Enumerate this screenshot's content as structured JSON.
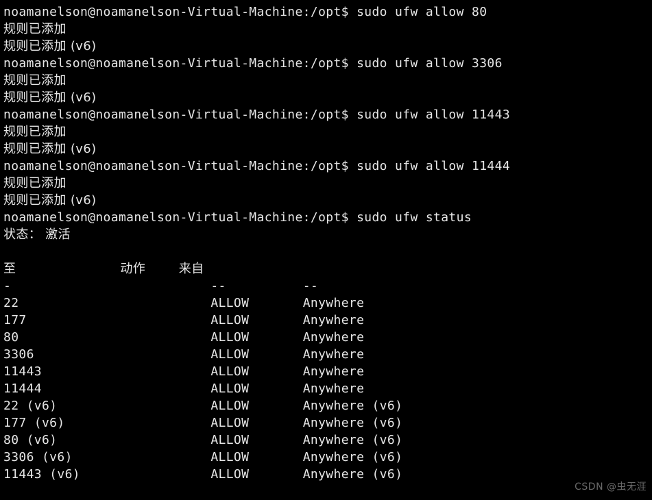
{
  "terminal": {
    "prompt": "noamanelson@noamanelson-Virtual-Machine:/opt$",
    "colors": {
      "background": "#000000",
      "foreground": "#e6e6e6",
      "watermark": "#6a6a6a"
    },
    "lines": [
      {
        "type": "command",
        "prompt": "noamanelson@noamanelson-Virtual-Machine:/opt$",
        "command": " sudo ufw allow 80"
      },
      {
        "type": "output",
        "text": "规则已添加"
      },
      {
        "type": "output",
        "text": "规则已添加 (v6)"
      },
      {
        "type": "command",
        "prompt": "noamanelson@noamanelson-Virtual-Machine:/opt$",
        "command": " sudo ufw allow 3306"
      },
      {
        "type": "output",
        "text": "规则已添加"
      },
      {
        "type": "output",
        "text": "规则已添加 (v6)"
      },
      {
        "type": "command",
        "prompt": "noamanelson@noamanelson-Virtual-Machine:/opt$",
        "command": " sudo ufw allow 11443"
      },
      {
        "type": "output",
        "text": "规则已添加"
      },
      {
        "type": "output",
        "text": "规则已添加 (v6)"
      },
      {
        "type": "command",
        "prompt": "noamanelson@noamanelson-Virtual-Machine:/opt$",
        "command": " sudo ufw allow 11444"
      },
      {
        "type": "output",
        "text": "规则已添加"
      },
      {
        "type": "output",
        "text": "规则已添加 (v6)"
      },
      {
        "type": "command",
        "prompt": "noamanelson@noamanelson-Virtual-Machine:/opt$",
        "command": " sudo ufw status"
      },
      {
        "type": "output",
        "text": "状态： 激活"
      },
      {
        "type": "blank",
        "text": ""
      },
      {
        "type": "table-header",
        "to": "至",
        "action": "动作",
        "from": "来自"
      },
      {
        "type": "table-separator",
        "to": "-",
        "action": "--",
        "from": "--"
      },
      {
        "type": "table-row",
        "to": "22",
        "action": "ALLOW",
        "from": "Anywhere"
      },
      {
        "type": "table-row",
        "to": "177",
        "action": "ALLOW",
        "from": "Anywhere"
      },
      {
        "type": "table-row",
        "to": "80",
        "action": "ALLOW",
        "from": "Anywhere"
      },
      {
        "type": "table-row",
        "to": "3306",
        "action": "ALLOW",
        "from": "Anywhere"
      },
      {
        "type": "table-row",
        "to": "11443",
        "action": "ALLOW",
        "from": "Anywhere"
      },
      {
        "type": "table-row",
        "to": "11444",
        "action": "ALLOW",
        "from": "Anywhere"
      },
      {
        "type": "table-row",
        "to": "22 (v6)",
        "action": "ALLOW",
        "from": "Anywhere (v6)"
      },
      {
        "type": "table-row",
        "to": "177 (v6)",
        "action": "ALLOW",
        "from": "Anywhere (v6)"
      },
      {
        "type": "table-row",
        "to": "80 (v6)",
        "action": "ALLOW",
        "from": "Anywhere (v6)"
      },
      {
        "type": "table-row",
        "to": "3306 (v6)",
        "action": "ALLOW",
        "from": "Anywhere (v6)"
      },
      {
        "type": "table-row",
        "to": "11443 (v6)",
        "action": "ALLOW",
        "from": "Anywhere (v6)"
      }
    ],
    "watermark": "CSDN @虫无涯"
  }
}
